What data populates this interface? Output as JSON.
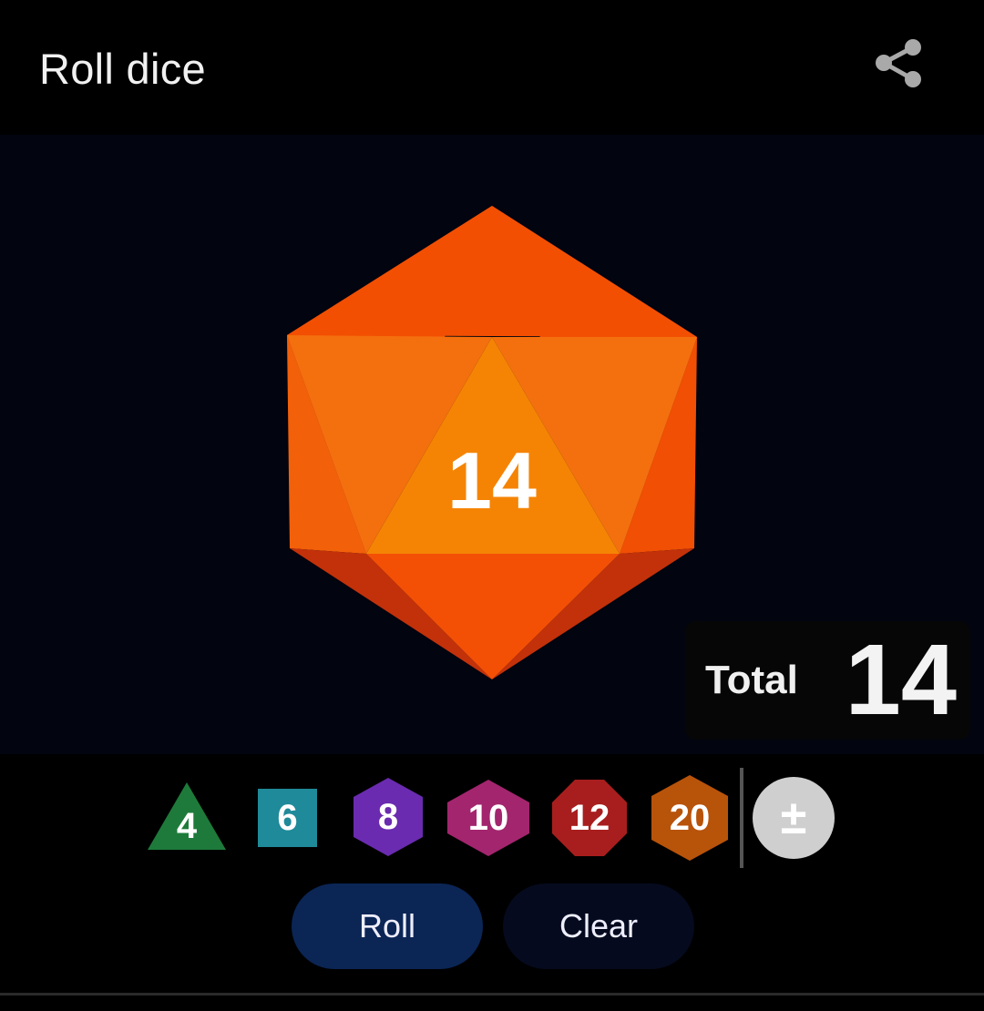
{
  "app": {
    "title": "Roll dice"
  },
  "result": {
    "die_value": "14",
    "total_label": "Total",
    "total_value": "14"
  },
  "dice": [
    {
      "label": "4",
      "shape": "triangle",
      "color": "#1e7a3a"
    },
    {
      "label": "6",
      "shape": "square",
      "color": "#1f8a99"
    },
    {
      "label": "8",
      "shape": "hexagon",
      "color": "#6a2bb0"
    },
    {
      "label": "10",
      "shape": "hexagon",
      "color": "#a3256e"
    },
    {
      "label": "12",
      "shape": "octagon",
      "color": "#a81e1e"
    },
    {
      "label": "20",
      "shape": "hexagon",
      "color": "#b8530a"
    }
  ],
  "modifier": {
    "symbol": "±"
  },
  "actions": {
    "roll": "Roll",
    "clear": "Clear"
  },
  "icons": {
    "share": "share-icon",
    "modifier": "plus-minus-icon"
  },
  "colors": {
    "die_main": "#f46a0b",
    "background": "#02040f"
  }
}
